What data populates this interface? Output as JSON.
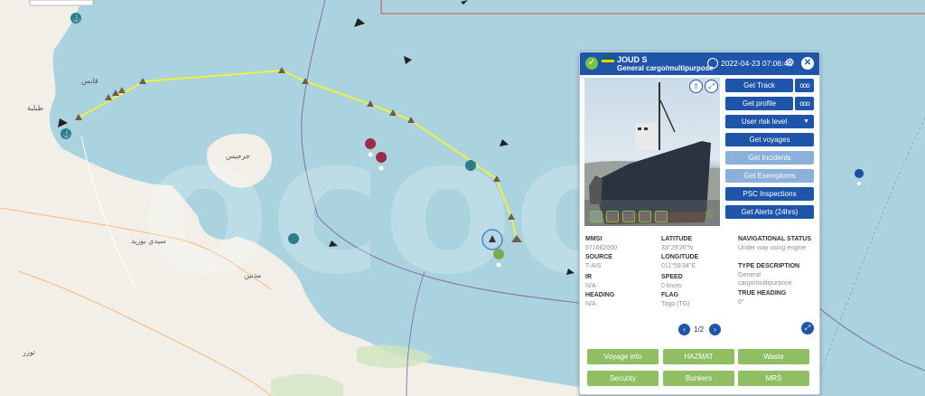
{
  "vessel": {
    "name": "JOUD S",
    "type": "General cargo/multipurpose",
    "timestamp": "2022-04-23 07:06:46"
  },
  "actions": {
    "get_track": "Get Track",
    "get_profile": "Get profile",
    "user_risk_level": "User risk level",
    "get_voyages": "Get voyages",
    "get_incidents": "Get Incidents",
    "get_exemptions": "Get Exemptions",
    "psc_inspections": "PSC Inspections",
    "get_alerts": "Get Alerts (24hrs)",
    "more": "ooo"
  },
  "details": {
    "mmsi": {
      "label": "MMSI",
      "value": "671662000"
    },
    "source": {
      "label": "SOURCE",
      "value": "T-AIS"
    },
    "ir": {
      "label": "IR",
      "value": "N/A"
    },
    "heading": {
      "label": "HEADING",
      "value": "N/A"
    },
    "latitude": {
      "label": "LATITUDE",
      "value": "33°29'26\"N"
    },
    "longitude": {
      "label": "LONGITUDE",
      "value": "011°59'34\"E"
    },
    "speed": {
      "label": "SPEED",
      "value": "0 knots"
    },
    "flag": {
      "label": "FLAG",
      "value": "Togo (TG)"
    },
    "nav_status": {
      "label": "NAVIGATIONAL STATUS",
      "value": "Under way using engine"
    },
    "type_desc": {
      "label": "TYPE DESCRIPTION",
      "value": "General cargo/multipurpose"
    },
    "true_heading": {
      "label": "TRUE HEADING",
      "value": "0°"
    }
  },
  "pager": {
    "text": "1/2"
  },
  "footer": {
    "voyage_info": "Voyage info",
    "hazmat": "HAZMAT",
    "waste": "Waste",
    "security": "Security",
    "bunkers": "Bunkers",
    "mrs": "MRS"
  },
  "map": {
    "labels": [
      "طبلبة",
      "قابس",
      "توزر",
      "مدنين",
      "جرجيس",
      "سيدي بوزيد"
    ]
  },
  "colors": {
    "panel_header": "#1f55a8",
    "button": "#1f55a8",
    "footer_button": "#8fbe63",
    "track": "#eef23c",
    "sea": "#aad3df",
    "land": "#f2efe9"
  }
}
